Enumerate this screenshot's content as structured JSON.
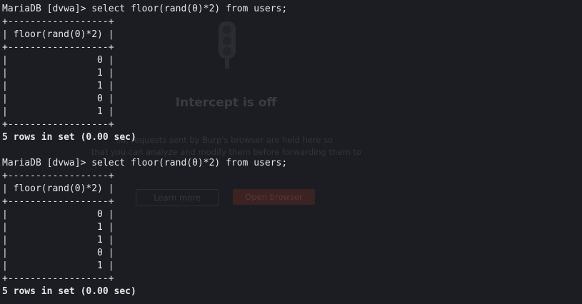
{
  "terminal": {
    "lines": [
      {
        "text": "MariaDB [dvwa]> select floor(rand(0)*2) from users;",
        "kind": "prompt"
      },
      {
        "text": "+------------------+",
        "kind": "border"
      },
      {
        "text": "| floor(rand(0)*2) |",
        "kind": "header"
      },
      {
        "text": "+------------------+",
        "kind": "border"
      },
      {
        "text": "|                0 |",
        "kind": "row"
      },
      {
        "text": "|                1 |",
        "kind": "row"
      },
      {
        "text": "|                1 |",
        "kind": "row"
      },
      {
        "text": "|                0 |",
        "kind": "row"
      },
      {
        "text": "|                1 |",
        "kind": "row"
      },
      {
        "text": "+------------------+",
        "kind": "border"
      },
      {
        "text": "5 rows in set (0.00 sec)",
        "kind": "status"
      },
      {
        "text": "",
        "kind": "blank"
      },
      {
        "text": "MariaDB [dvwa]> select floor(rand(0)*2) from users;",
        "kind": "prompt"
      },
      {
        "text": "+------------------+",
        "kind": "border"
      },
      {
        "text": "| floor(rand(0)*2) |",
        "kind": "header"
      },
      {
        "text": "+------------------+",
        "kind": "border"
      },
      {
        "text": "|                0 |",
        "kind": "row"
      },
      {
        "text": "|                1 |",
        "kind": "row"
      },
      {
        "text": "|                1 |",
        "kind": "row"
      },
      {
        "text": "|                0 |",
        "kind": "row"
      },
      {
        "text": "|                1 |",
        "kind": "row"
      },
      {
        "text": "+------------------+",
        "kind": "border"
      },
      {
        "text": "5 rows in set (0.00 sec)",
        "kind": "status"
      }
    ]
  },
  "background_window": {
    "icon": "traffic-light-icon",
    "title": "Intercept is off",
    "description_line1": "ed, requests sent by Burp's browser are held here so",
    "description_line2": "that you can analyze and modify them before forwarding them to",
    "learn_more_label": "Learn more",
    "open_browser_label": "Open browser"
  },
  "colors": {
    "terminal_background": "#1c1d22",
    "terminal_text": "#e6e6e6",
    "ghost_text": "#3a3b40",
    "ghost_accent": "#3a2321"
  }
}
